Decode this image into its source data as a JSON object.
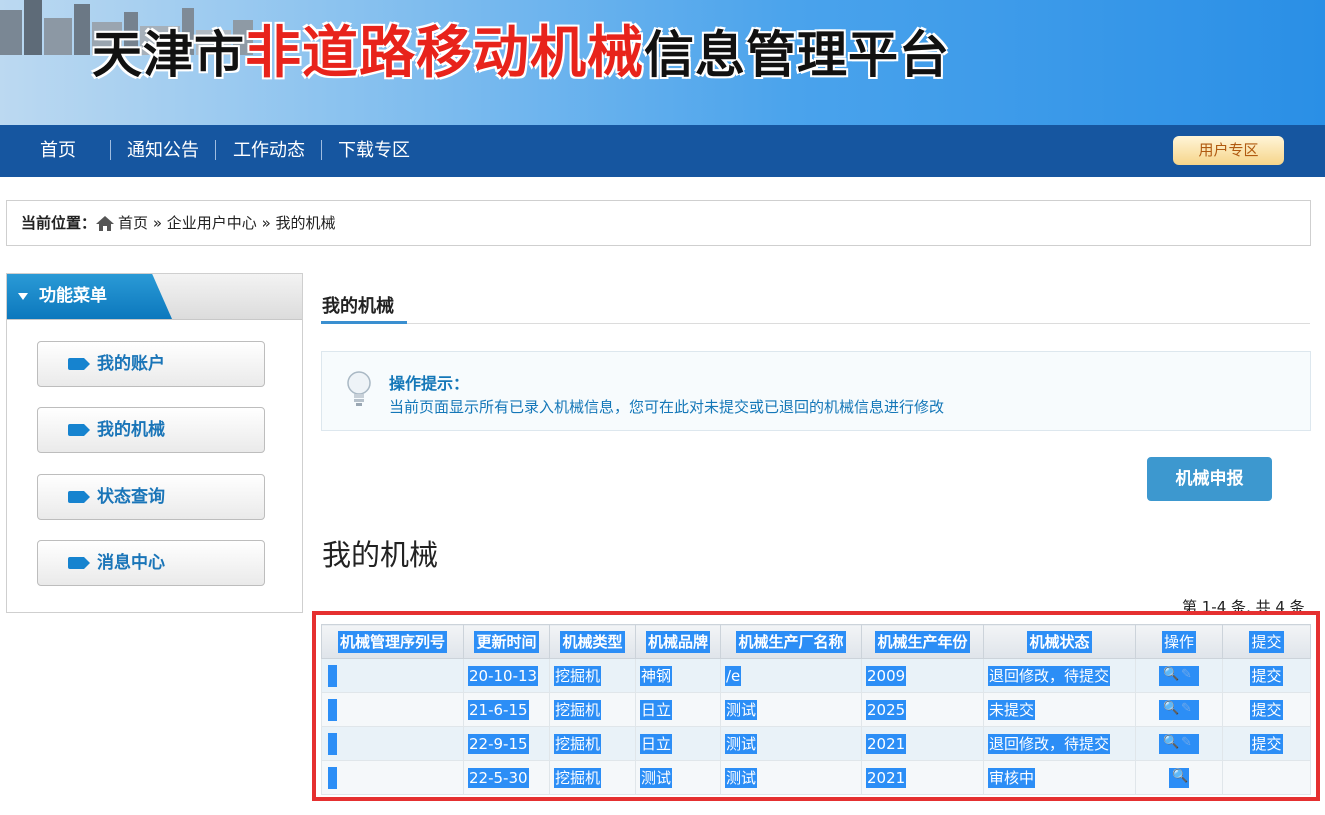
{
  "banner": {
    "title_prefix": "天津市",
    "title_highlight": "非道路移动机械",
    "title_suffix": "信息管理平台"
  },
  "nav": {
    "items": [
      "首页",
      "通知公告",
      "工作动态",
      "下载专区"
    ],
    "user_area": "用户专区"
  },
  "breadcrumb": {
    "label": "当前位置：",
    "path": [
      "首页",
      "企业用户中心",
      "我的机械"
    ],
    "separator": "»"
  },
  "sidebar": {
    "title": "功能菜单",
    "items": [
      "我的账户",
      "我的机械",
      "状态查询",
      "消息中心"
    ]
  },
  "content": {
    "section_title": "我的机械",
    "tip_title": "操作提示：",
    "tip_text": "当前页面显示所有已录入机械信息，您可在此对未提交或已退回的机械信息进行修改",
    "apply_button": "机械申报",
    "list_title": "我的机械",
    "count_text": "第 1-4 条, 共 4 条"
  },
  "table": {
    "headers": [
      "机械管理序列号",
      "更新时间",
      "机械类型",
      "机械品牌",
      "机械生产厂名称",
      "机械生产年份",
      "机械状态",
      "操作",
      "提交"
    ],
    "rows": [
      {
        "serial": "",
        "updated": "20-10-13",
        "type": "挖掘机",
        "brand": "神钢",
        "maker": "/e",
        "year": "2009",
        "status": "退回修改，待提交",
        "submit": "提交"
      },
      {
        "serial": "",
        "updated": "21-6-15",
        "type": "挖掘机",
        "brand": "日立",
        "maker": "测试",
        "year": "2025",
        "status": "未提交",
        "submit": "提交"
      },
      {
        "serial": "",
        "updated": "22-9-15",
        "type": "挖掘机",
        "brand": "日立",
        "maker": "测试",
        "year": "2021",
        "status": "退回修改，待提交",
        "submit": "提交"
      },
      {
        "serial": "",
        "updated": "22-5-30",
        "type": "挖掘机",
        "brand": "测试",
        "maker": "测试",
        "year": "2021",
        "status": "审核中",
        "submit": ""
      }
    ]
  },
  "colors": {
    "nav_bg": "#1656a0",
    "accent": "#1683cf",
    "selection": "#2c8ef6",
    "highlight_border": "#e53030",
    "banner_red": "#e8231b"
  }
}
